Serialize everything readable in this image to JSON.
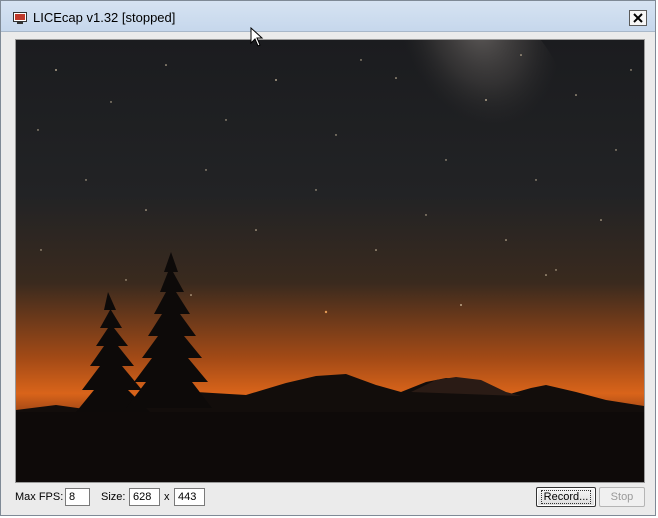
{
  "window": {
    "title": "LICEcap v1.32 [stopped]",
    "icon": "licecap-app-icon",
    "close_icon": "close-icon"
  },
  "capture": {
    "content": "night sky with milky way over mountain silhouette and pine trees"
  },
  "statusbar": {
    "max_fps_label": "Max FPS:",
    "max_fps_value": "8",
    "size_label": "Size:",
    "width_value": "628",
    "times_label": "x",
    "height_value": "443",
    "record_label": "Record...",
    "stop_label": "Stop"
  },
  "colors": {
    "title_bar": "#c6d7ec",
    "window_bg": "#ebebeb",
    "sky_top": "#1b1c1f",
    "horizon_glow": "#d9641a"
  }
}
